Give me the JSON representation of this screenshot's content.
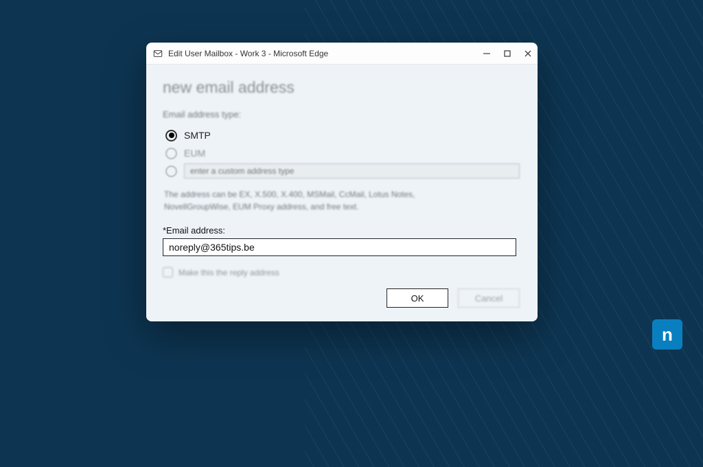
{
  "window": {
    "title": "Edit User Mailbox - Work 3 - Microsoft Edge"
  },
  "dialog": {
    "heading": "new email address",
    "type_label": "Email address type:",
    "radios": {
      "smtp": "SMTP",
      "eum": "EUM",
      "custom_placeholder": "enter a custom address type"
    },
    "help_text": "The address can be EX, X.500, X.400, MSMail, CcMail, Lotus Notes, NovellGroupWise, EUM Proxy address, and free text.",
    "email_label": "*Email address:",
    "email_value": "noreply@365tips.be",
    "reply_checkbox_label": "Make this the reply address",
    "ok_label": "OK",
    "cancel_label": "Cancel"
  },
  "brand": {
    "logo_letter": "n"
  }
}
